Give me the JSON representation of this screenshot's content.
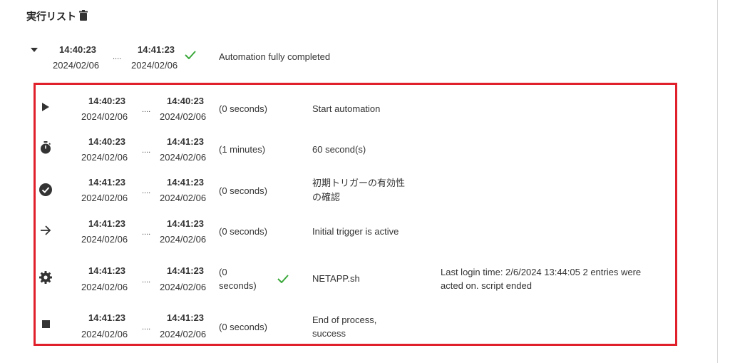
{
  "header": {
    "title": "実行リスト",
    "trash_icon": "trash-icon"
  },
  "summary": {
    "start_time": "14:40:23",
    "start_date": "2024/02/06",
    "end_time": "14:41:23",
    "end_date": "2024/02/06",
    "dots": "....",
    "status": "Automation fully completed",
    "status_icon": "check-icon"
  },
  "steps": [
    {
      "icon": "play-icon",
      "start_time": "14:40:23",
      "start_date": "2024/02/06",
      "end_time": "14:40:23",
      "end_date": "2024/02/06",
      "dots": "....",
      "duration": "(0 seconds)",
      "name": "Start automation",
      "detail": ""
    },
    {
      "icon": "stopwatch-icon",
      "start_time": "14:40:23",
      "start_date": "2024/02/06",
      "end_time": "14:41:23",
      "end_date": "2024/02/06",
      "dots": "....",
      "duration": "(1 minutes)",
      "name": "60 second(s)",
      "detail": ""
    },
    {
      "icon": "check-circle-icon",
      "start_time": "14:41:23",
      "start_date": "2024/02/06",
      "end_time": "14:41:23",
      "end_date": "2024/02/06",
      "dots": "....",
      "duration": "(0 seconds)",
      "name": "初期トリガーの有効性の確認",
      "name_line1": "初期トリガーの有効性",
      "name_line2": "の確認",
      "detail": ""
    },
    {
      "icon": "arrow-right-icon",
      "start_time": "14:41:23",
      "start_date": "2024/02/06",
      "end_time": "14:41:23",
      "end_date": "2024/02/06",
      "dots": "....",
      "duration": "(0 seconds)",
      "name": "Initial trigger is active",
      "detail": ""
    },
    {
      "icon": "gear-icon",
      "start_time": "14:41:23",
      "start_date": "2024/02/06",
      "end_time": "14:41:23",
      "end_date": "2024/02/06",
      "dots": "....",
      "duration_line1": "(0",
      "duration_line2": "seconds)",
      "status_icon": "check-icon",
      "name": "NETAPP.sh",
      "detail_line1": "Last login time: 2/6/2024 13:44:05 2 entries were",
      "detail_line2": "acted on. script ended"
    },
    {
      "icon": "stop-icon",
      "start_time": "14:41:23",
      "start_date": "2024/02/06",
      "end_time": "14:41:23",
      "end_date": "2024/02/06",
      "dots": "....",
      "duration": "(0 seconds)",
      "name_line1": "End of process,",
      "name_line2": "success",
      "detail": ""
    }
  ],
  "colors": {
    "highlight_border": "#e0202b",
    "check_green": "#3aa83a",
    "icon_dark": "#333333"
  }
}
